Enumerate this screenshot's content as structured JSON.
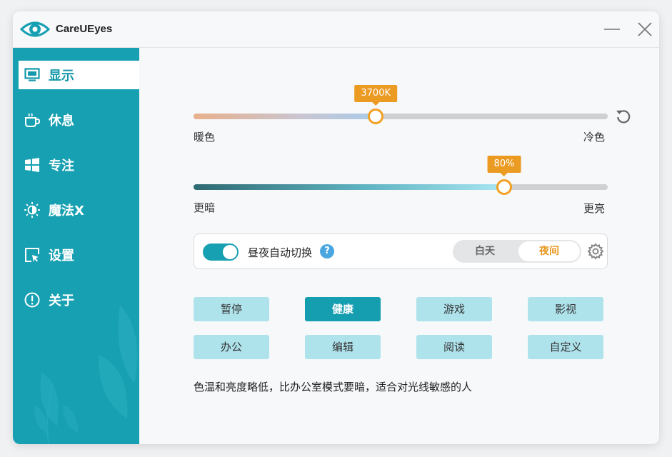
{
  "app": {
    "title": "CareUEyes"
  },
  "sidebar": {
    "items": [
      {
        "label": "显示",
        "icon": "monitor-icon",
        "active": true
      },
      {
        "label": "休息",
        "icon": "coffee-cup-icon",
        "active": false
      },
      {
        "label": "专注",
        "icon": "windows-logo-icon",
        "active": false
      },
      {
        "label": "魔法X",
        "icon": "sun-moon-icon",
        "active": false
      },
      {
        "label": "设置",
        "icon": "cursor-window-icon",
        "active": false
      },
      {
        "label": "关于",
        "icon": "info-icon",
        "active": false
      }
    ]
  },
  "color_temp": {
    "value": "3700K",
    "fraction": 0.44,
    "left_label": "暖色",
    "right_label": "冷色"
  },
  "brightness": {
    "value": "80%",
    "fraction": 0.75,
    "left_label": "更暗",
    "right_label": "更亮"
  },
  "auto_switch": {
    "enabled": true,
    "label": "昼夜自动切换",
    "help": "?",
    "day_label": "白天",
    "night_label": "夜间",
    "selected": "夜间"
  },
  "modes": [
    {
      "label": "暂停",
      "active": false
    },
    {
      "label": "健康",
      "active": true
    },
    {
      "label": "游戏",
      "active": false
    },
    {
      "label": "影视",
      "active": false
    },
    {
      "label": "办公",
      "active": false
    },
    {
      "label": "编辑",
      "active": false
    },
    {
      "label": "阅读",
      "active": false
    },
    {
      "label": "自定义",
      "active": false
    }
  ],
  "description": "色温和亮度略低，比办公室模式要暗，适合对光线敏感的人",
  "colors": {
    "accent": "#17a0b2",
    "orange": "#eb9a22",
    "mode_idle": "#aee3ec"
  }
}
